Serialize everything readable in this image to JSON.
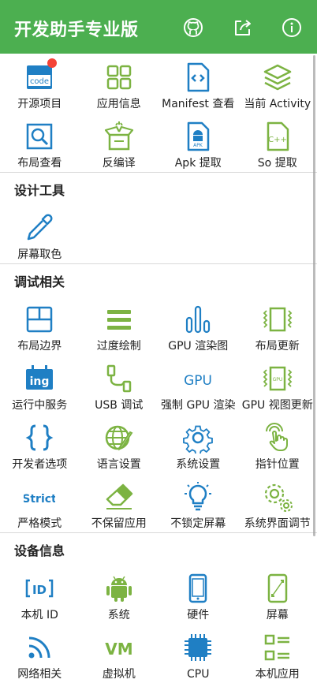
{
  "header": {
    "title": "开发助手专业版"
  },
  "colors": {
    "header": "#4caf50",
    "green_icon": "#7cb342",
    "blue_icon": "#1f7fc4"
  },
  "top_items": [
    {
      "label": "开源项目"
    },
    {
      "label": "应用信息"
    },
    {
      "label": "Manifest 查看"
    },
    {
      "label": "当前 Activity"
    },
    {
      "label": "布局查看"
    },
    {
      "label": "反编译"
    },
    {
      "label": "Apk 提取"
    },
    {
      "label": "So 提取"
    }
  ],
  "design": {
    "title": "设计工具",
    "items": [
      {
        "label": "屏幕取色"
      }
    ]
  },
  "debug": {
    "title": "调试相关",
    "items": [
      {
        "label": "布局边界"
      },
      {
        "label": "过度绘制"
      },
      {
        "label": "GPU 渲染图"
      },
      {
        "label": "布局更新"
      },
      {
        "label": "运行中服务"
      },
      {
        "label": "USB 调试"
      },
      {
        "label": "强制 GPU 渲染"
      },
      {
        "label": "GPU 视图更新"
      },
      {
        "label": "开发者选项"
      },
      {
        "label": "语言设置"
      },
      {
        "label": "系统设置"
      },
      {
        "label": "指针位置"
      },
      {
        "label": "严格模式"
      },
      {
        "label": "不保留应用"
      },
      {
        "label": "不锁定屏幕"
      },
      {
        "label": "系统界面调节"
      }
    ]
  },
  "device": {
    "title": "设备信息",
    "items": [
      {
        "label": "本机 ID"
      },
      {
        "label": "系统"
      },
      {
        "label": "硬件"
      },
      {
        "label": "屏幕"
      },
      {
        "label": "网络相关"
      },
      {
        "label": "虚拟机"
      },
      {
        "label": "CPU"
      },
      {
        "label": "本机应用"
      }
    ]
  },
  "icon_text": {
    "code": "code",
    "apk": "APK",
    "cpp": "C++",
    "ing": "ing",
    "gpu": "GPU",
    "strict": "Strict",
    "id": "ID",
    "vm": "VM"
  }
}
